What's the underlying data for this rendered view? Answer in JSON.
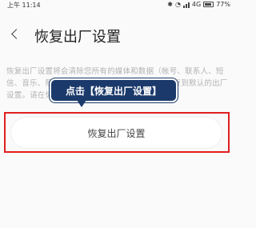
{
  "status_bar": {
    "time": "上午 11:14",
    "network": "4G",
    "battery_text": "77%",
    "icons": [
      "bluetooth-icon",
      "wifi-icon",
      "signal-icon",
      "battery-icon"
    ]
  },
  "header": {
    "back_icon": "chevron-left-icon",
    "title": "恢复出厂设置"
  },
  "description": "恢复出厂设置将会清除您所有的媒体和数据（帐号、联系人、短信、音乐、照片、应用程序等），并将您的手机恢复到默认的出厂设置。请在恢复出厂设置前备份您的数据。",
  "reset_button": {
    "label": "恢复出厂设置"
  },
  "annotation": {
    "text": "点击【恢复出厂设置】",
    "color": "#1b3a6b",
    "highlight_color": "#e02020"
  }
}
